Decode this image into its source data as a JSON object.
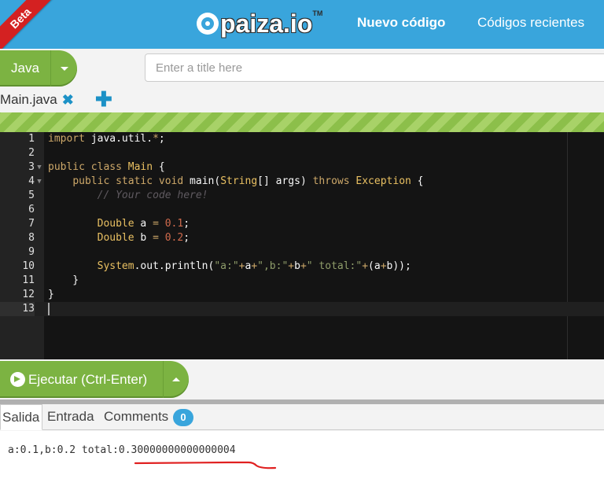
{
  "header": {
    "beta_label": "Beta",
    "logo_text": "paiza.io",
    "logo_tm": "TM",
    "nav": {
      "new_code": "Nuevo código",
      "recent_codes": "Códigos recientes"
    }
  },
  "toolbar": {
    "language": "Java",
    "title_placeholder": "Enter a title here",
    "title_value": ""
  },
  "files": {
    "active": "Main.java",
    "close_glyph": "✖",
    "add_glyph": "✚"
  },
  "editor": {
    "lines": [
      "import java.util.*;",
      "",
      "public class Main {",
      "    public static void main(String[] args) throws Exception {",
      "        // Your code here!",
      "",
      "        Double a = 0.1;",
      "        Double b = 0.2;",
      "",
      "        System.out.println(\"a:\"+a+\",b:\"+b+\" total:\"+(a+b));",
      "    }",
      "}",
      ""
    ],
    "folded_lines": [
      3,
      4
    ],
    "active_line": 13
  },
  "run": {
    "label": "Ejecutar (Ctrl-Enter)"
  },
  "output": {
    "tabs": {
      "salida": "Salida",
      "entrada": "Entrada",
      "comments": "Comments"
    },
    "comments_count": "0",
    "text": "a:0.1,b:0.2 total:0.30000000000000004"
  },
  "colors": {
    "header_blue": "#39a5dc",
    "button_green": "#7cb342",
    "editor_bg": "#141414",
    "annotation_red": "#e02020"
  }
}
